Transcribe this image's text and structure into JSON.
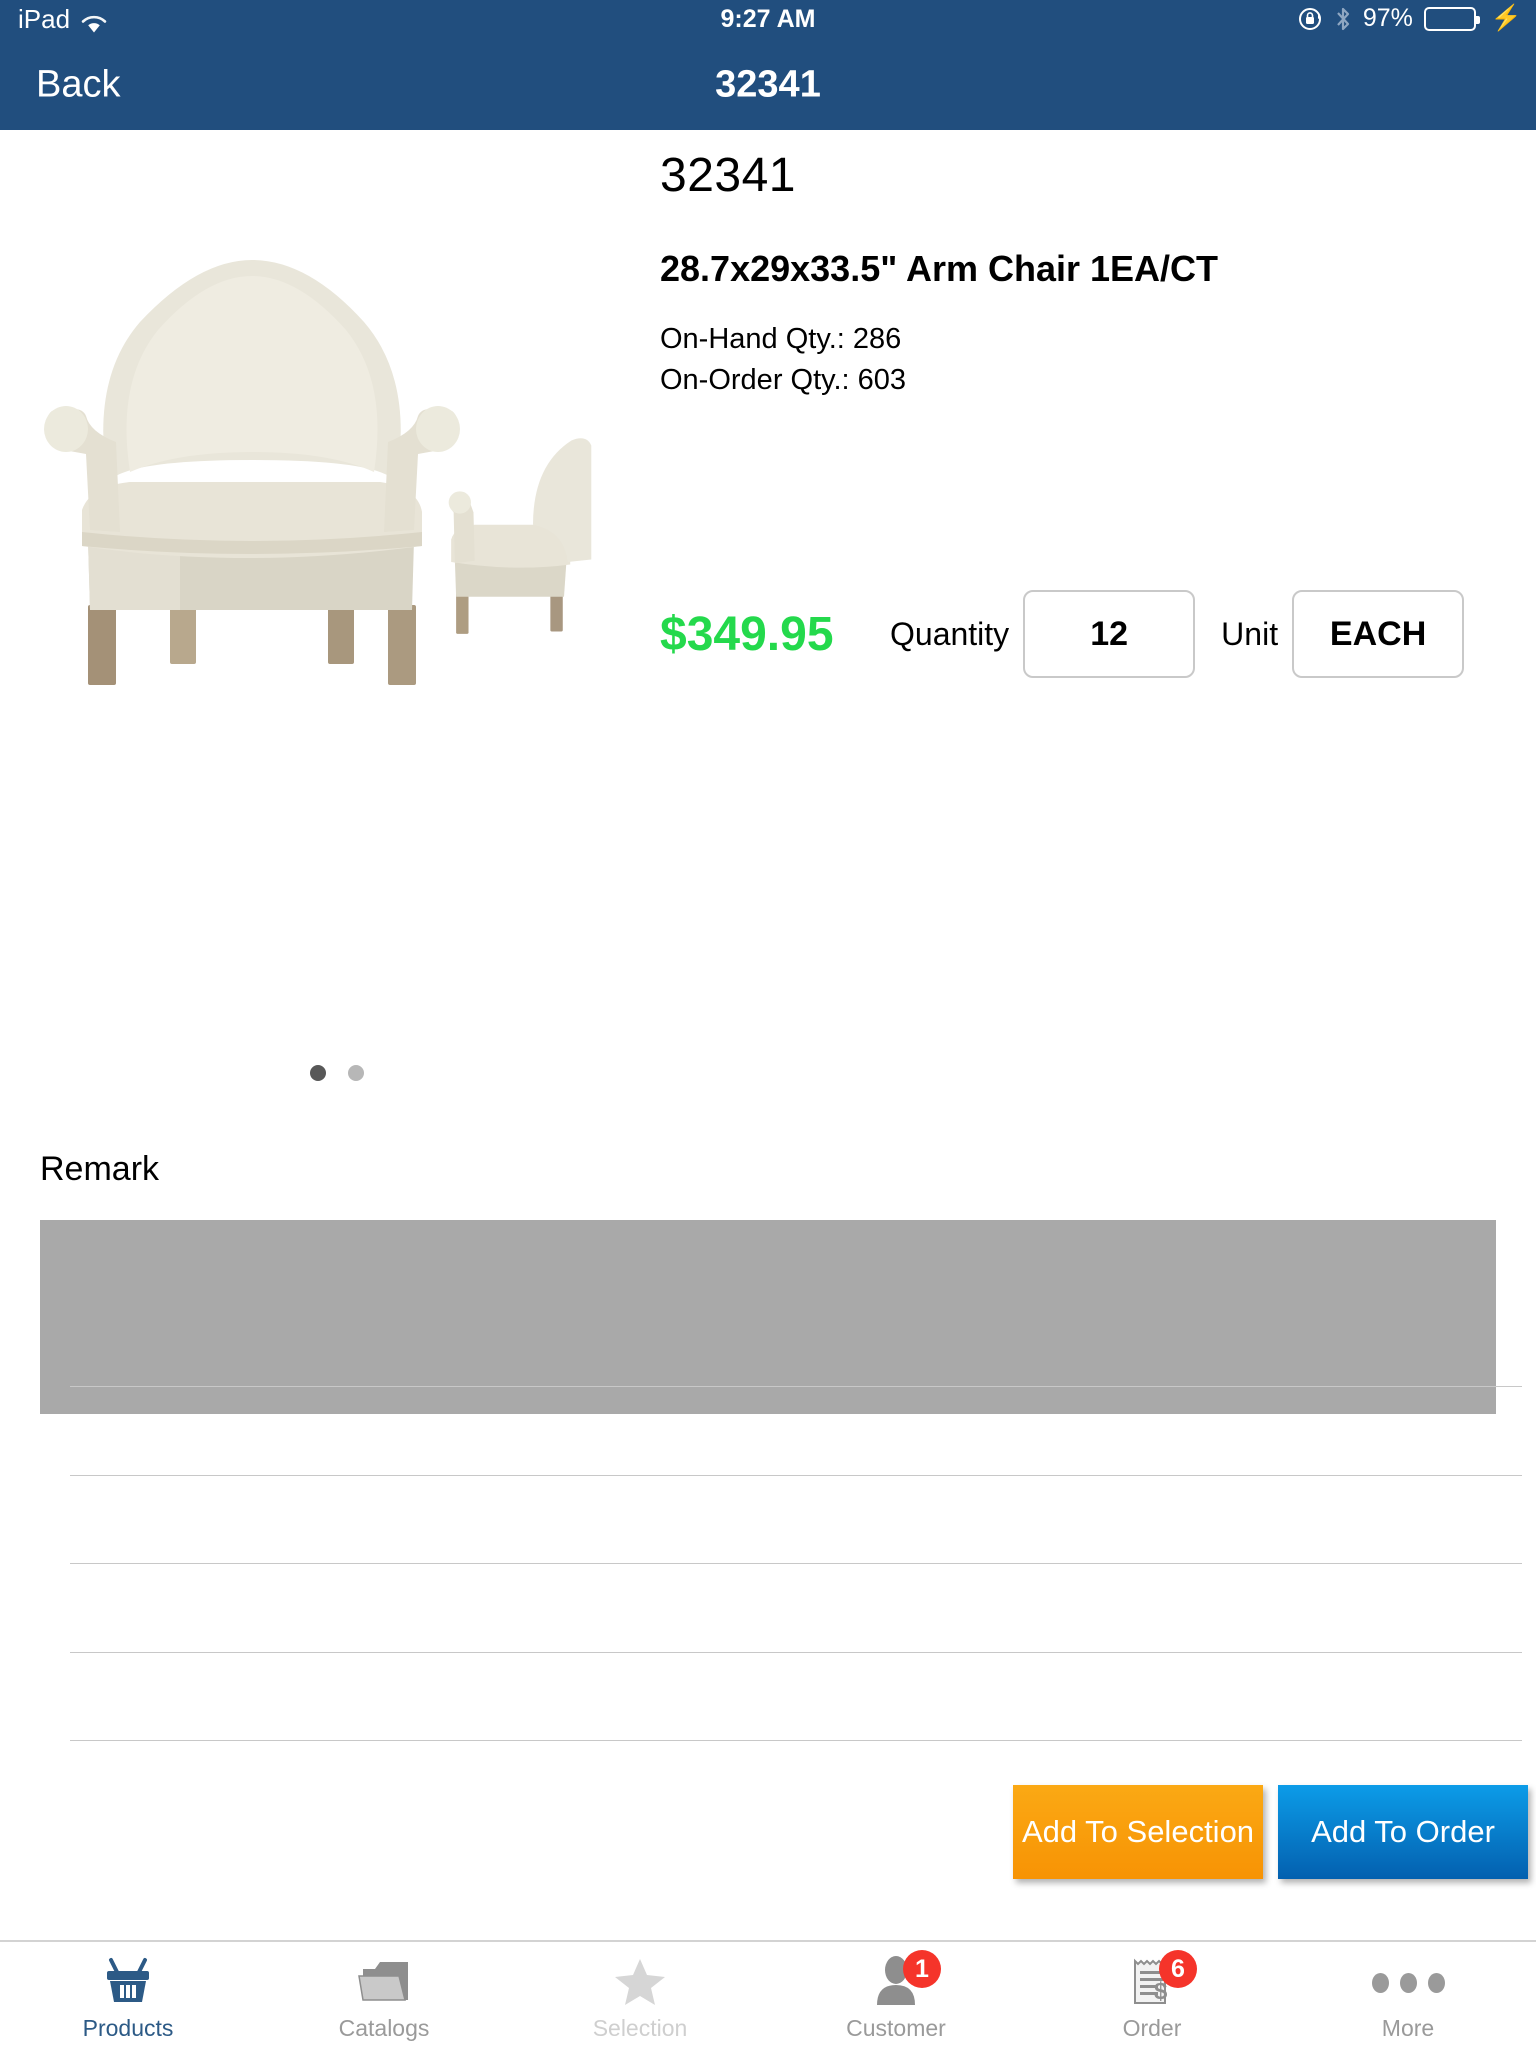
{
  "status_bar": {
    "carrier": "iPad",
    "wifi_icon": "wifi-icon",
    "time": "9:27 AM",
    "rotation_lock_icon": "rotation-lock-icon",
    "bluetooth_icon": "bluetooth-icon",
    "battery_percent": "97%",
    "battery_level": 97,
    "charging_icon": "lightning-bolt-icon",
    "background_color": "#214E7E"
  },
  "nav_bar": {
    "back_label": "Back",
    "title": "32341"
  },
  "product": {
    "code": "32341",
    "name": "28.7x29x33.5\" Arm Chair 1EA/CT",
    "on_hand_label": "On-Hand Qty.: 286",
    "on_order_label": "On-Order Qty.: 603",
    "price": "$349.95",
    "price_color": "#24D94C",
    "image_alt": "arm-chair-front-and-side-view"
  },
  "order_form": {
    "quantity_label": "Quantity",
    "quantity_value": "12",
    "unit_label": "Unit",
    "unit_value": "EACH"
  },
  "gallery": {
    "total_pages": 2,
    "current_page": 1
  },
  "remark": {
    "label": "Remark",
    "value": "",
    "field_color": "#a9a9a9"
  },
  "separators": {
    "count": 5,
    "color": "#c8c8c8"
  },
  "actions": {
    "add_to_selection": "Add To Selection",
    "add_to_selection_color": "#F79F0A",
    "add_to_order": "Add To Order",
    "add_to_order_color": "#0B7FD0"
  },
  "tab_bar": {
    "items": [
      {
        "label": "Products",
        "icon": "basket-icon",
        "state": "active",
        "badge": null
      },
      {
        "label": "Catalogs",
        "icon": "folder-icon",
        "state": "normal",
        "badge": null
      },
      {
        "label": "Selection",
        "icon": "star-icon",
        "state": "faded",
        "badge": null
      },
      {
        "label": "Customer",
        "icon": "person-icon",
        "state": "normal",
        "badge": "1"
      },
      {
        "label": "Order",
        "icon": "receipt-icon",
        "state": "normal",
        "badge": "6"
      },
      {
        "label": "More",
        "icon": "ellipsis-icon",
        "state": "normal",
        "badge": null
      }
    ]
  }
}
